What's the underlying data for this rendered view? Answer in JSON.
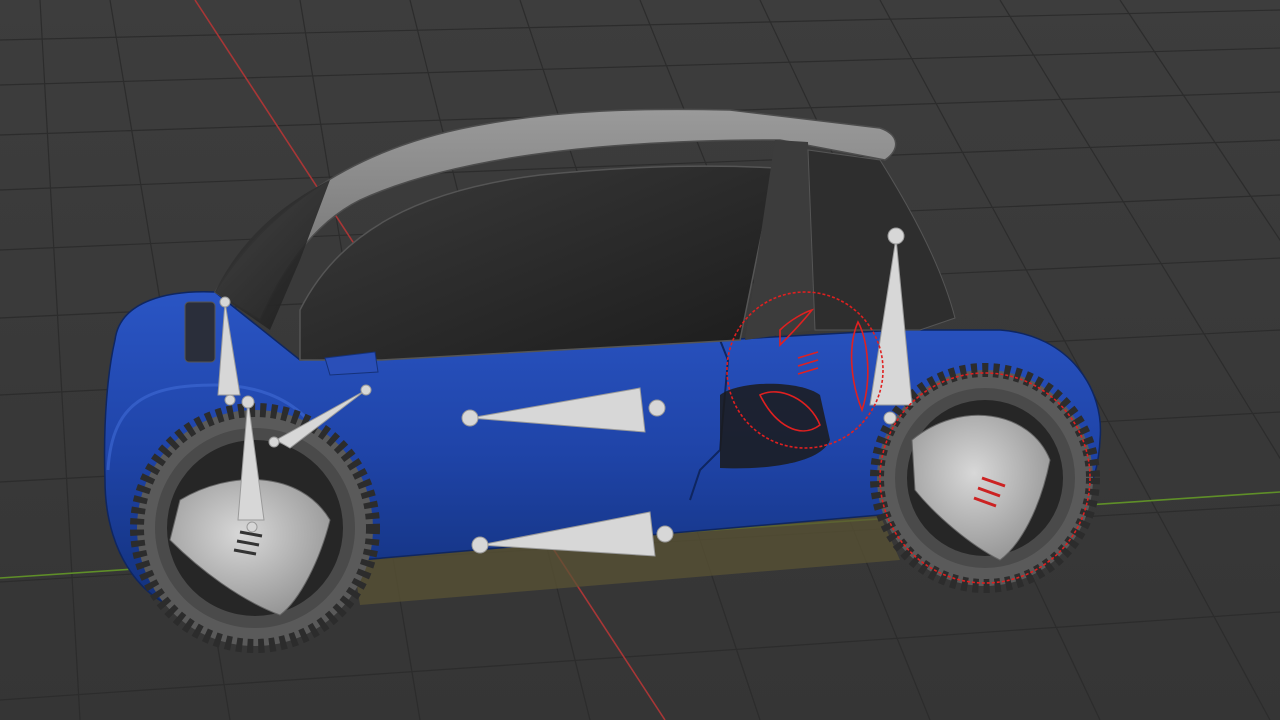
{
  "viewport": {
    "type": "3d-viewport",
    "background_color": "#3b3b3b",
    "grid_color": "#2a2a2a",
    "x_axis_color": "#b23a3a",
    "y_axis_color": "#6a9a2a"
  },
  "model": {
    "subject": "compact-electric-car",
    "body_color": "#1f44a8",
    "roof_color": "#8a8a8a",
    "glass_color": "#2a2a2a",
    "wheel_color": "#bdbdbd",
    "tire_color": "#4a4a4a"
  },
  "rig": {
    "bone_color": "#d7d7d7",
    "selected_constraint_color": "#e02020"
  }
}
